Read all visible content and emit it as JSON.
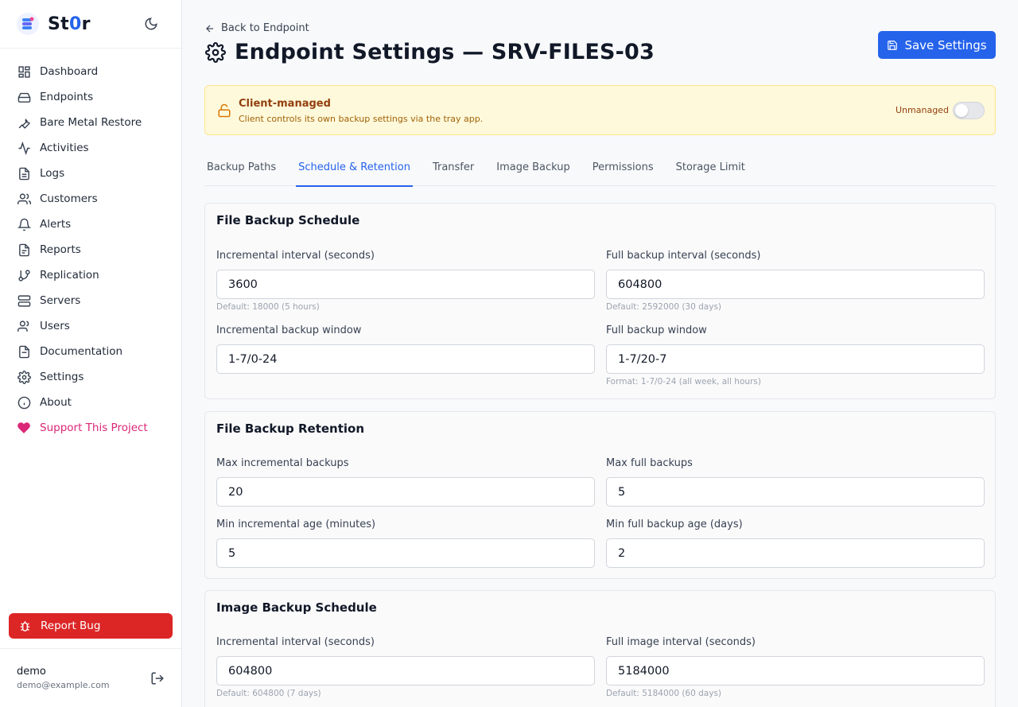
{
  "brand": {
    "name_prefix": "St",
    "name_accent": "0",
    "name_suffix": "r"
  },
  "sidebar": {
    "items": [
      {
        "label": "Dashboard",
        "icon": "dashboard-icon"
      },
      {
        "label": "Endpoints",
        "icon": "hard-drive-icon"
      },
      {
        "label": "Bare Metal Restore",
        "icon": "wrench-icon"
      },
      {
        "label": "Activities",
        "icon": "activity-icon"
      },
      {
        "label": "Logs",
        "icon": "file-text-icon"
      },
      {
        "label": "Customers",
        "icon": "users-icon"
      },
      {
        "label": "Alerts",
        "icon": "bell-icon"
      },
      {
        "label": "Reports",
        "icon": "report-icon"
      },
      {
        "label": "Replication",
        "icon": "git-branch-icon"
      },
      {
        "label": "Servers",
        "icon": "server-icon"
      },
      {
        "label": "Users",
        "icon": "user-group-icon"
      },
      {
        "label": "Documentation",
        "icon": "document-icon"
      },
      {
        "label": "Settings",
        "icon": "gear-icon"
      },
      {
        "label": "About",
        "icon": "info-icon"
      },
      {
        "label": "Support This Project",
        "icon": "heart-icon"
      }
    ],
    "report_bug": "Report Bug",
    "user": {
      "name": "demo",
      "email": "demo@example.com"
    }
  },
  "header": {
    "back_label": "Back to Endpoint",
    "title": "Endpoint Settings — SRV-FILES-03",
    "save_label": "Save Settings"
  },
  "banner": {
    "title": "Client-managed",
    "subtitle": "Client controls its own backup settings via the tray app.",
    "toggle_label": "Unmanaged",
    "toggle_on": false
  },
  "tabs": [
    {
      "label": "Backup Paths",
      "active": false
    },
    {
      "label": "Schedule & Retention",
      "active": true
    },
    {
      "label": "Transfer",
      "active": false
    },
    {
      "label": "Image Backup",
      "active": false
    },
    {
      "label": "Permissions",
      "active": false
    },
    {
      "label": "Storage Limit",
      "active": false
    }
  ],
  "file_schedule": {
    "title": "File Backup Schedule",
    "incr_interval": {
      "label": "Incremental interval (seconds)",
      "value": "3600",
      "hint": "Default: 18000 (5 hours)"
    },
    "full_interval": {
      "label": "Full backup interval (seconds)",
      "value": "604800",
      "hint": "Default: 2592000 (30 days)"
    },
    "incr_window": {
      "label": "Incremental backup window",
      "value": "1-7/0-24"
    },
    "full_window": {
      "label": "Full backup window",
      "value": "1-7/20-7",
      "hint": "Format: 1-7/0-24 (all week, all hours)"
    }
  },
  "file_retention": {
    "title": "File Backup Retention",
    "max_incr": {
      "label": "Max incremental backups",
      "value": "20"
    },
    "max_full": {
      "label": "Max full backups",
      "value": "5"
    },
    "min_incr_age": {
      "label": "Min incremental age (minutes)",
      "value": "5"
    },
    "min_full_age": {
      "label": "Min full backup age (days)",
      "value": "2"
    }
  },
  "image_schedule": {
    "title": "Image Backup Schedule",
    "incr_interval": {
      "label": "Incremental interval (seconds)",
      "value": "604800",
      "hint": "Default: 604800 (7 days)"
    },
    "full_interval": {
      "label": "Full image interval (seconds)",
      "value": "5184000",
      "hint": "Default: 5184000 (60 days)"
    }
  },
  "colors": {
    "accent": "#2563eb",
    "danger": "#dc2626",
    "support": "#db2777",
    "banner_bg": "#fef9db"
  }
}
